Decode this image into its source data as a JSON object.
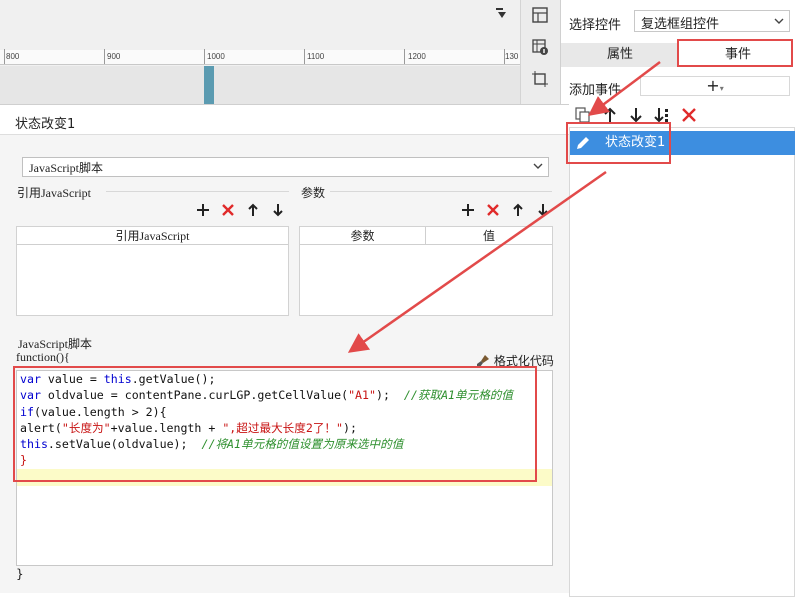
{
  "ruler": {
    "labels": [
      "800",
      "900",
      "1000",
      "1100",
      "1200",
      "130"
    ]
  },
  "right_panel": {
    "select_widget_label": "选择控件",
    "selected_widget": "复选框组控件",
    "tabs": {
      "attributes": "属性",
      "events": "事件"
    },
    "add_event_label": "添加事件",
    "add_event_button": "+",
    "event_item": "状态改变1"
  },
  "dialog": {
    "title": "状态改变1",
    "script_type": "JavaScript脚本",
    "ref_js_label": "引用JavaScript",
    "params_label": "参数",
    "ref_js_column": "引用JavaScript",
    "param_columns": [
      "参数",
      "值"
    ],
    "js_script_label": "JavaScript脚本",
    "function_open": "function(){",
    "format_code": "格式化代码",
    "function_close": "}"
  },
  "code": {
    "line1": {
      "a": "var",
      "b": " value = ",
      "c": "this",
      "d": ".getValue();"
    },
    "line2": {
      "a": "var",
      "b": " oldvalue = contentPane.curLGP.getCellValue(",
      "c": "\"A1\"",
      "d": ");  ",
      "e": "//获取A1单元格的值"
    },
    "line3": {
      "a": "if",
      "b": "(value.length > 2){"
    },
    "line4": {
      "a": "alert(",
      "b": "\"长度为\"",
      "c": "+value.length + ",
      "d": "\",超过最大长度2了！\"",
      "e": ");"
    },
    "line5": {
      "a": "this",
      "b": ".setValue(oldvalue);  ",
      "c": "//将A1单元格的值设置为原来选中的值"
    },
    "line6": {
      "a": "}"
    }
  },
  "colors": {
    "accent_red": "#e24a4a",
    "selection_blue": "#3d8ee0",
    "current_line": "#fcfbc8",
    "keyword": "#0000d0",
    "string": "#c81414",
    "comment": "#2d8f2d"
  }
}
